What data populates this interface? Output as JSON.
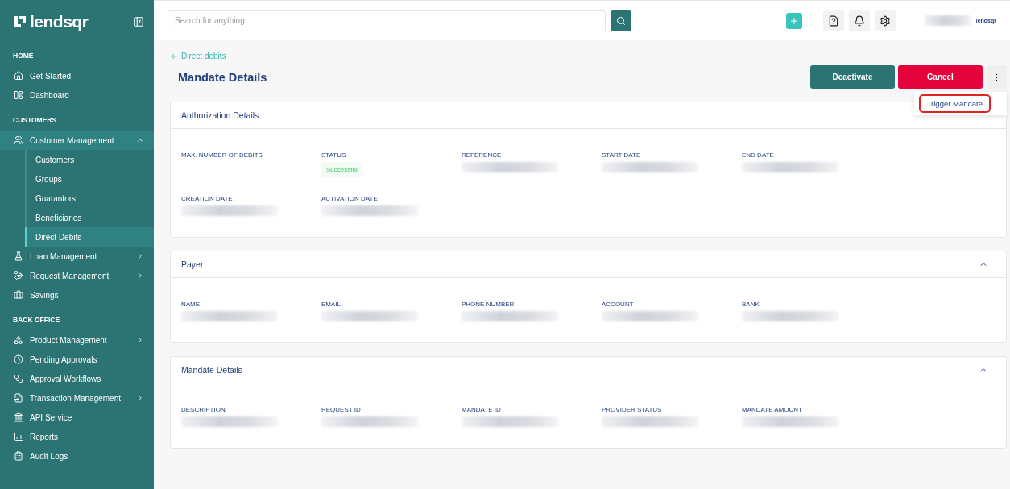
{
  "brand": {
    "logo": "lendsqr",
    "small_logo": "lendsqr"
  },
  "sidebar": {
    "sections": [
      {
        "title": "HOME",
        "items": [
          {
            "label": "Get Started",
            "selected": false
          },
          {
            "label": "Dashboard",
            "selected": false
          }
        ]
      },
      {
        "title": "CUSTOMERS",
        "items": [
          {
            "label": "Customer Management",
            "selected": true,
            "expanded": true,
            "children": [
              {
                "label": "Customers",
                "selected": false
              },
              {
                "label": "Groups",
                "selected": false
              },
              {
                "label": "Guarantors",
                "selected": false
              },
              {
                "label": "Beneficiaries",
                "selected": false
              },
              {
                "label": "Direct Debits",
                "selected": true
              }
            ]
          },
          {
            "label": "Loan Management",
            "selected": false,
            "expanded": false
          },
          {
            "label": "Request Management",
            "selected": false,
            "expanded": false
          },
          {
            "label": "Savings",
            "selected": false
          }
        ]
      },
      {
        "title": "BACK OFFICE",
        "items": [
          {
            "label": "Product Management",
            "selected": false,
            "expanded": false
          },
          {
            "label": "Pending Approvals",
            "selected": false
          },
          {
            "label": "Approval Workflows",
            "selected": false
          },
          {
            "label": "Transaction Management",
            "selected": false,
            "expanded": false
          },
          {
            "label": "API Service",
            "selected": false
          },
          {
            "label": "Reports",
            "selected": false
          },
          {
            "label": "Audit Logs",
            "selected": false
          }
        ]
      }
    ]
  },
  "search": {
    "placeholder": "Search for anything"
  },
  "breadcrumb": "Direct debits",
  "page_title": "Mandate Details",
  "actions": [
    {
      "label": "Deactivate",
      "kind": "primary"
    },
    {
      "label": "Cancel",
      "kind": "danger"
    }
  ],
  "menu": {
    "open": true,
    "items": [
      {
        "label": "Trigger Mandate",
        "highlighted": true
      }
    ]
  },
  "cards": [
    {
      "title": "Authorization Details",
      "expanded": true,
      "rows": [
        [
          {
            "label": "MAX. NUMBER OF DEBITS",
            "kind": "empty"
          },
          {
            "label": "STATUS",
            "kind": "badge",
            "value": "Successful"
          },
          {
            "label": "REFERENCE",
            "kind": "redacted"
          },
          {
            "label": "START DATE",
            "kind": "redacted"
          },
          {
            "label": "END DATE",
            "kind": "redacted"
          }
        ],
        [
          {
            "label": "CREATION DATE",
            "kind": "redacted"
          },
          {
            "label": "ACTIVATION DATE",
            "kind": "redacted"
          }
        ]
      ]
    },
    {
      "title": "Payer",
      "expanded": true,
      "rows": [
        [
          {
            "label": "NAME",
            "kind": "redacted"
          },
          {
            "label": "EMAIL",
            "kind": "redacted"
          },
          {
            "label": "PHONE NUMBER",
            "kind": "redacted"
          },
          {
            "label": "ACCOUNT",
            "kind": "redacted"
          },
          {
            "label": "BANK",
            "kind": "redacted"
          }
        ]
      ]
    },
    {
      "title": "Mandate Details",
      "expanded": true,
      "rows": [
        [
          {
            "label": "DESCRIPTION",
            "kind": "redacted"
          },
          {
            "label": "REQUEST ID",
            "kind": "redacted"
          },
          {
            "label": "MANDATE ID",
            "kind": "redacted"
          },
          {
            "label": "PROVIDER STATUS",
            "kind": "redacted"
          },
          {
            "label": "MANDATE AMOUNT",
            "kind": "redacted"
          }
        ]
      ]
    }
  ]
}
